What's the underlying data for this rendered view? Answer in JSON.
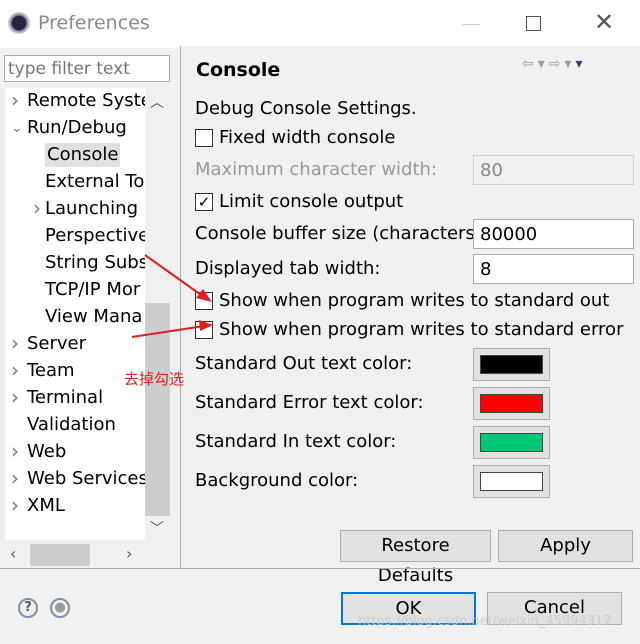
{
  "window": {
    "title": "Preferences"
  },
  "sidebar": {
    "filter_placeholder": "type filter text",
    "items": [
      {
        "label": "Remote Syste",
        "level": 0,
        "chevron": "right"
      },
      {
        "label": "Run/Debug",
        "level": 0,
        "chevron": "down"
      },
      {
        "label": "Console",
        "level": 1,
        "selected": true
      },
      {
        "label": "External Too",
        "level": 1
      },
      {
        "label": "Launching",
        "level": 1,
        "chevron": "right"
      },
      {
        "label": "Perspective",
        "level": 1
      },
      {
        "label": "String Subs",
        "level": 1
      },
      {
        "label": "TCP/IP Mor",
        "level": 1
      },
      {
        "label": "View Mana",
        "level": 1
      },
      {
        "label": "Server",
        "level": 0,
        "chevron": "right"
      },
      {
        "label": "Team",
        "level": 0,
        "chevron": "right"
      },
      {
        "label": "Terminal",
        "level": 0,
        "chevron": "right"
      },
      {
        "label": "Validation",
        "level": 0
      },
      {
        "label": "Web",
        "level": 0,
        "chevron": "right"
      },
      {
        "label": "Web Services",
        "level": 0,
        "chevron": "right"
      },
      {
        "label": "XML",
        "level": 0,
        "chevron": "right"
      }
    ]
  },
  "page": {
    "title": "Console",
    "section": "Debug Console Settings.",
    "fixed_width": {
      "label": "Fixed width console",
      "checked": false
    },
    "max_width": {
      "label": "Maximum character width:",
      "value": "80"
    },
    "limit_output": {
      "label": "Limit console output",
      "checked": true
    },
    "buffer_size": {
      "label": "Console buffer size (characters):",
      "value": "80000"
    },
    "tab_width": {
      "label": "Displayed tab width:",
      "value": "8"
    },
    "show_stdout": {
      "label": "Show when program writes to standard out",
      "checked": false
    },
    "show_stderr": {
      "label": "Show when program writes to standard error",
      "checked": false
    },
    "colors": [
      {
        "label": "Standard Out text color:",
        "color": "#000000"
      },
      {
        "label": "Standard Error text color:",
        "color": "#ff0000"
      },
      {
        "label": "Standard In text color:",
        "color": "#00c878"
      },
      {
        "label": "Background color:",
        "color": "#ffffff"
      }
    ],
    "restore_defaults": "Restore Defaults",
    "apply": "Apply"
  },
  "footer": {
    "ok": "OK",
    "cancel": "Cancel",
    "help_icon": "?"
  },
  "annotation": {
    "note": "去掉勾选",
    "color": "#e02020"
  },
  "watermark": "https://blog.csdn.net/weixin_45994317"
}
